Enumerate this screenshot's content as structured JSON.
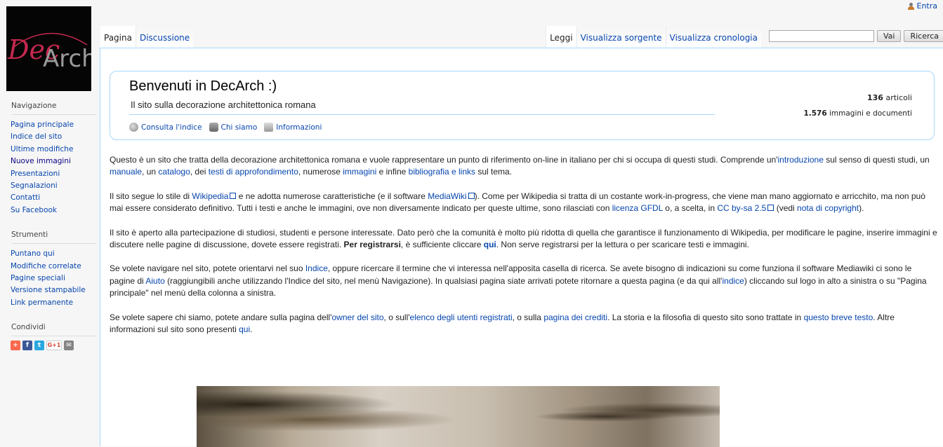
{
  "personal": {
    "login": "Entra"
  },
  "logo": {
    "text_left": "Dec",
    "text_right": "Arch"
  },
  "sidebar": {
    "navigation": {
      "title": "Navigazione",
      "items": [
        "Pagina principale",
        "Indice del sito",
        "Ultime modifiche",
        "Nuove immagini",
        "Presentazioni",
        "Segnalazioni",
        "Contatti",
        "Su Facebook"
      ]
    },
    "tools": {
      "title": "Strumenti",
      "items": [
        "Puntano qui",
        "Modifiche correlate",
        "Pagine speciali",
        "Versione stampabile",
        "Link permanente"
      ]
    },
    "share": {
      "title": "Condividi",
      "buttons": [
        "+",
        "f",
        "t",
        "G+1",
        "✉"
      ]
    }
  },
  "tabs": {
    "left": [
      "Pagina",
      "Discussione"
    ],
    "right": [
      "Leggi",
      "Visualizza sorgente",
      "Visualizza cronologia"
    ]
  },
  "search": {
    "value": "",
    "go": "Vai",
    "search": "Ricerca"
  },
  "welcome": {
    "title": "Benvenuti in DecArch :)",
    "subtitle": "Il sito sulla decorazione architettonica romana",
    "links": [
      "Consulta l'indice",
      "Chi siamo",
      "Informazioni"
    ],
    "stats": {
      "articles_count": "136",
      "articles_label": "articoli",
      "images_count": "1.576",
      "images_label": "immagini e documenti"
    }
  },
  "colors": {
    "link": "#0645ad",
    "border": "#a7d7f9",
    "logo_red": "#c5284e"
  },
  "body": {
    "p1": {
      "t1": "Questo è un sito che tratta della decorazione architettonica romana e vuole rappresentare un punto di riferimento on-line in italiano per chi si occupa di questi studi. Comprende un'",
      "l1": "introduzione",
      "t2": " sul senso di questi studi, un ",
      "l2": "manuale",
      "t3": ", un ",
      "l3": "catalogo",
      "t4": ", dei ",
      "l4": "testi di approfondimento",
      "t5": ", numerose ",
      "l5": "immagini",
      "t6": " e infine ",
      "l6": "bibliografia e links",
      "t7": " sul tema."
    },
    "p2": {
      "t1": "Il sito segue lo stile di ",
      "l1": "Wikipedia",
      "t2": " e ne adotta numerose caratteristiche (e il software ",
      "l2": "MediaWiki",
      "t3": "). Come per Wikipedia si tratta di un costante work-in-progress, che viene man mano aggiornato e arricchito, ma non può mai essere considerato definitivo. Tutti i testi e anche le immagini, ove non diversamente indicato per queste ultime, sono rilasciati con ",
      "l3": "licenza GFDL",
      "t4": " o, a scelta, in ",
      "l4": "CC by-sa 2.5",
      "t5": " (vedi ",
      "l5": "nota di copyright",
      "t6": ")."
    },
    "p3": {
      "t1": "Il sito è aperto alla partecipazione di studiosi, studenti e persone interessate. Dato però che la comunità è molto più ridotta di quella che garantisce il funzionamento di Wikipedia, per modificare le pagine, inserire immagini e discutere nelle pagine di discussione, dovete essere registrati. ",
      "b1": "Per registrarsi",
      "t2": ", è sufficiente cliccare ",
      "l1": "qui",
      "t3": ". Non serve registrarsi per la lettura o per scaricare testi e immagini."
    },
    "p4": {
      "t1": "Se volete navigare nel sito, potete orientarvi nel suo ",
      "l1": "Indice",
      "t2": ", oppure ricercare il termine che vi interessa nell'apposita casella di ricerca. Se avete bisogno di indicazioni su come funziona il software Mediawiki ci sono le pagine di ",
      "l2": "Aiuto",
      "t3": " (raggiungibili anche utilizzando l'Indice del sito, nel menù Navigazione). In qualsiasi pagina siate arrivati potete ritornare a questa pagina (e da qui all'",
      "l3": "indice",
      "t4": ") cliccando sul logo in alto a sinistra o su \"Pagina principale\" nel menù della colonna a sinistra."
    },
    "p5": {
      "t1": "Se volete sapere chi siamo, potete andare sulla pagina dell'",
      "l1": "owner del sito",
      "t2": ", o sull'",
      "l2": "elenco degli utenti registrati",
      "t3": ", o sulla ",
      "l3": "pagina dei crediti",
      "t4": ". La storia e la filosofia di questo sito sono trattate in ",
      "l4": "questo breve testo",
      "t5": ". Altre informazioni sul sito sono presenti ",
      "l5": "qui",
      "t6": "."
    }
  }
}
